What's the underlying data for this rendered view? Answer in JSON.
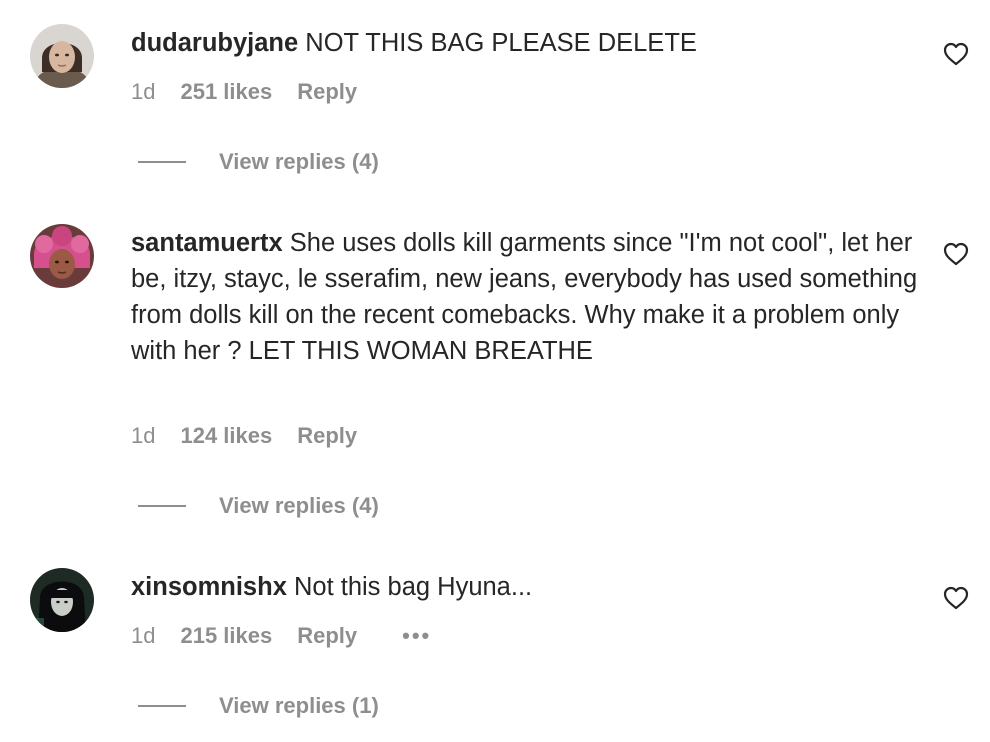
{
  "comments": [
    {
      "username": "dudarubyjane",
      "text": "NOT THIS BAG PLEASE DELETE",
      "time": "1d",
      "likes": "251 likes",
      "reply": "Reply",
      "view_replies": "View replies (4)",
      "avatar_icon": "avatar-portrait"
    },
    {
      "username": "santamuertx",
      "text": "She uses dolls kill garments since \"I'm not cool\", let her be, itzy, stayc, le sserafim, new jeans, everybody has used something from dolls kill on the recent comebacks. Why make it a problem only with her ? LET THIS WOMAN BREATHE",
      "time": "1d",
      "likes": "124 likes",
      "reply": "Reply",
      "view_replies": "View replies (4)",
      "avatar_icon": "avatar-portrait"
    },
    {
      "username": "xinsomnishx",
      "text": "Not this bag Hyuna...",
      "time": "1d",
      "likes": "215 likes",
      "reply": "Reply",
      "more": "•••",
      "view_replies": "View replies (1)",
      "avatar_icon": "avatar-portrait"
    }
  ],
  "icons": {
    "like": "heart-outline-icon",
    "more": "more-options-icon"
  },
  "colors": {
    "text": "#262626",
    "secondary": "#8e8e8e",
    "background": "#ffffff"
  }
}
